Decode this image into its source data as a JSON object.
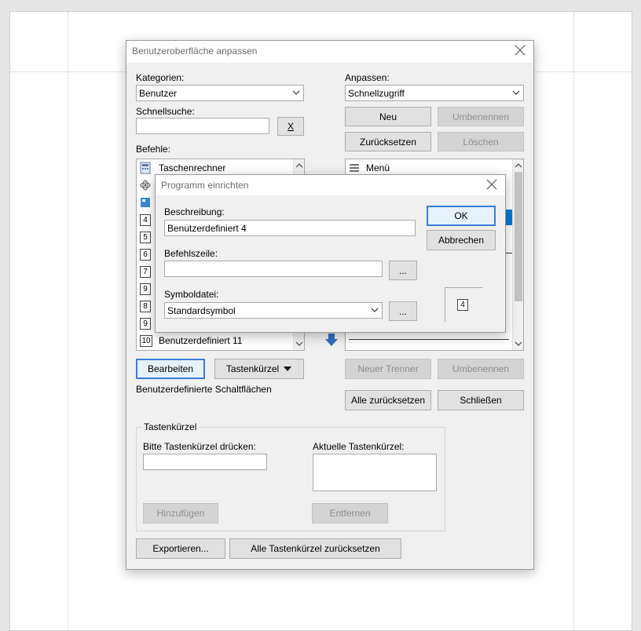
{
  "main_dialog": {
    "title": "Benutzeroberfläche anpassen",
    "kategorien_label": "Kategorien:",
    "kategorien_value": "Benutzer",
    "schnellsuche_label": "Schnellsuche:",
    "schnellsuche_clear": "X",
    "befehle_label": "Befehle:",
    "befehle_items": [
      {
        "label": "Taschenrechner",
        "icon": "calculator-icon"
      },
      {
        "label": "",
        "icon": "atom-icon"
      },
      {
        "label": "",
        "icon": "app-icon"
      },
      {
        "label": "",
        "num": "4"
      },
      {
        "label": "",
        "num": "5"
      },
      {
        "label": "",
        "num": "6"
      },
      {
        "label": "",
        "num": "7"
      },
      {
        "label": "",
        "num": "9"
      },
      {
        "label": "",
        "num": "8"
      },
      {
        "label": "",
        "num": "9"
      },
      {
        "label": "Benutzerdefiniert 11",
        "num": "10"
      }
    ],
    "bearbeiten": "Bearbeiten",
    "tastenkuerzel": "Tastenkürzel",
    "custom_buttons_caption": "Benutzerdefinierte Schaltflächen",
    "anpassen_label": "Anpassen:",
    "anpassen_value": "Schnellzugriff",
    "neu": "Neu",
    "umbenennen": "Umbenennen",
    "zuruecksetzen": "Zurücksetzen",
    "loeschen": "Löschen",
    "right_list_first": "Menü",
    "neuer_trenner": "Neuer Trenner",
    "umbenennen2": "Umbenennen",
    "alle_zuruecksetzen": "Alle zurücksetzen",
    "schliessen": "Schließen",
    "group_title": "Tastenkürzel",
    "bitte_label": "Bitte Tastenkürzel drücken:",
    "aktuelle_label": "Aktuelle Tastenkürzel:",
    "hinzufuegen": "Hinzufügen",
    "entfernen": "Entfernen",
    "exportieren": "Exportieren...",
    "alle_tasten_reset": "Alle Tastenkürzel zurücksetzen"
  },
  "sub_dialog": {
    "title": "Programm einrichten",
    "beschreibung_label": "Beschreibung:",
    "beschreibung_value": "Benutzerdefiniert 4",
    "befehlszeile_label": "Befehlszeile:",
    "befehlszeile_value": "",
    "browse": "...",
    "symboldatei_label": "Symboldatei:",
    "symboldatei_value": "Standardsymbol",
    "ok": "OK",
    "abbrechen": "Abbrechen",
    "preview_num": "4"
  },
  "colors": {
    "accent": "#3b7dd8",
    "selection": "#0078d7",
    "dialog_bg": "#f0f0f0",
    "move_arrow": "#2e6fc0"
  }
}
